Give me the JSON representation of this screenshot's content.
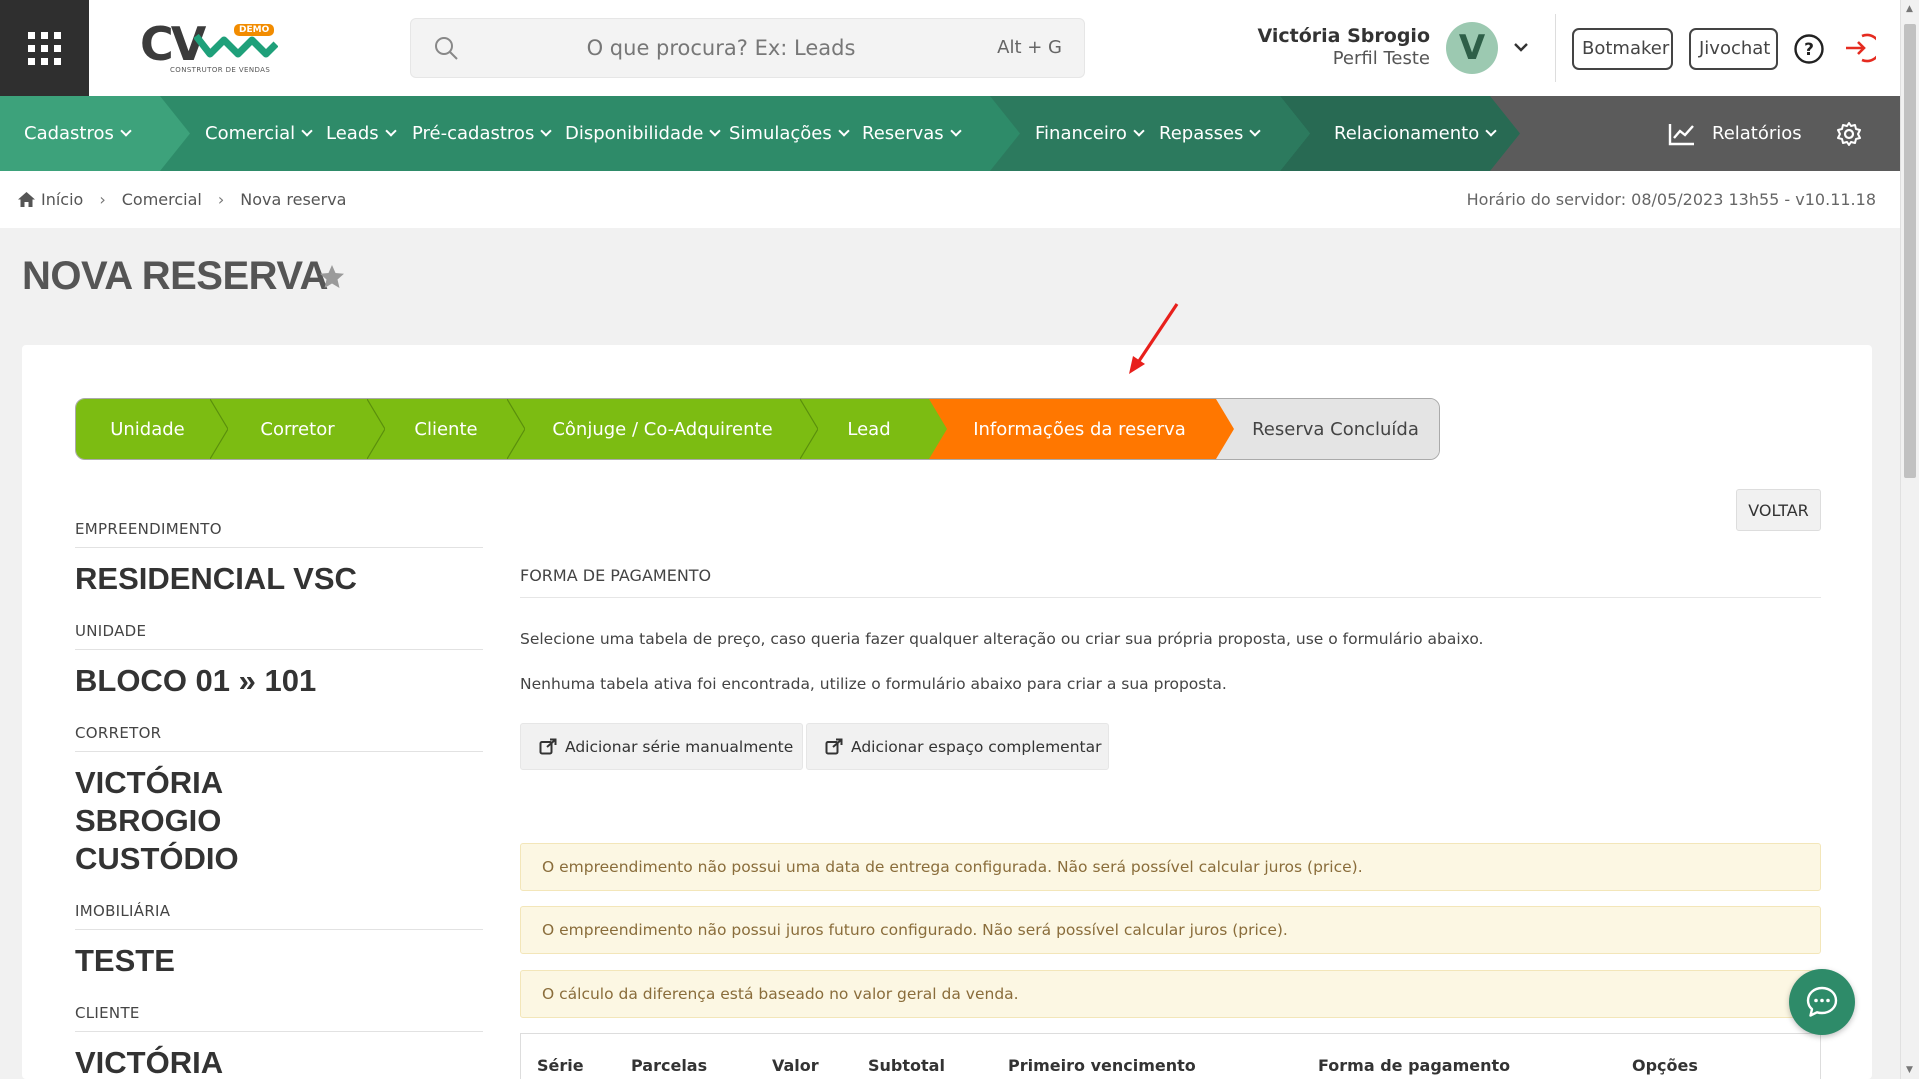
{
  "header": {
    "logo_text": "CV",
    "logo_badge": "DEMO",
    "logo_subtitle": "CONSTRUTOR DE VENDAS",
    "search_placeholder": "O que procura? Ex: Leads",
    "search_shortcut": "Alt + G",
    "user_name": "Victória Sbrogio",
    "user_profile": "Perfil Teste",
    "avatar_letter": "V",
    "botmaker_label": "Botmaker",
    "jivochat_label": "Jivochat"
  },
  "nav": {
    "items": [
      "Cadastros",
      "Comercial",
      "Leads",
      "Pré-cadastros",
      "Disponibilidade",
      "Simulações",
      "Reservas",
      "Financeiro",
      "Repasses",
      "Relacionamento"
    ],
    "reports_label": "Relatórios"
  },
  "breadcrumb": {
    "items": [
      "Início",
      "Comercial",
      "Nova reserva"
    ],
    "server_time": "Horário do servidor: 08/05/2023 13h55 - v10.11.18"
  },
  "page": {
    "title": "NOVA RESERVA",
    "back_label": "VOLTAR"
  },
  "wizard": {
    "steps": [
      {
        "label": "Unidade",
        "state": "done"
      },
      {
        "label": "Corretor",
        "state": "done"
      },
      {
        "label": "Cliente",
        "state": "done"
      },
      {
        "label": "Cônjuge / Co-Adquirente",
        "state": "done"
      },
      {
        "label": "Lead",
        "state": "done"
      },
      {
        "label": "Informações da reserva",
        "state": "active"
      },
      {
        "label": "Reserva Concluída",
        "state": "todo"
      }
    ]
  },
  "summary": {
    "fields": [
      {
        "label": "EMPREENDIMENTO",
        "value": "RESIDENCIAL VSC"
      },
      {
        "label": "UNIDADE",
        "value": "BLOCO 01 » 101"
      },
      {
        "label": "CORRETOR",
        "value": "VICTÓRIA SBROGIO CUSTÓDIO"
      },
      {
        "label": "IMOBILIÁRIA",
        "value": "TESTE"
      },
      {
        "label": "CLIENTE",
        "value": "VICTÓRIA"
      }
    ]
  },
  "payment": {
    "section_label": "FORMA DE PAGAMENTO",
    "text1": "Selecione uma tabela de preço, caso queria fazer qualquer alteração ou criar sua própria proposta, use o formulário abaixo.",
    "text2": "Nenhuma tabela ativa foi encontrada, utilize o formulário abaixo para criar a sua proposta.",
    "add_series_label": "Adicionar série manualmente",
    "add_space_label": "Adicionar espaço complementar",
    "alerts": [
      "O empreendimento não possui uma data de entrega configurada. Não será possível calcular juros (price).",
      "O empreendimento não possui juros futuro configurado. Não será possível calcular juros (price).",
      "O cálculo da diferença está baseado no valor geral da venda."
    ],
    "table_headers": [
      "Série",
      "Parcelas",
      "Valor",
      "Subtotal",
      "Primeiro vencimento",
      "Forma de pagamento",
      "Opções"
    ]
  },
  "colors": {
    "nav_green": "#2e8b69",
    "step_done": "#7cbc12",
    "step_active": "#ff7700",
    "alert_bg": "#fcf7e3",
    "alert_text": "#8a6d3b"
  }
}
